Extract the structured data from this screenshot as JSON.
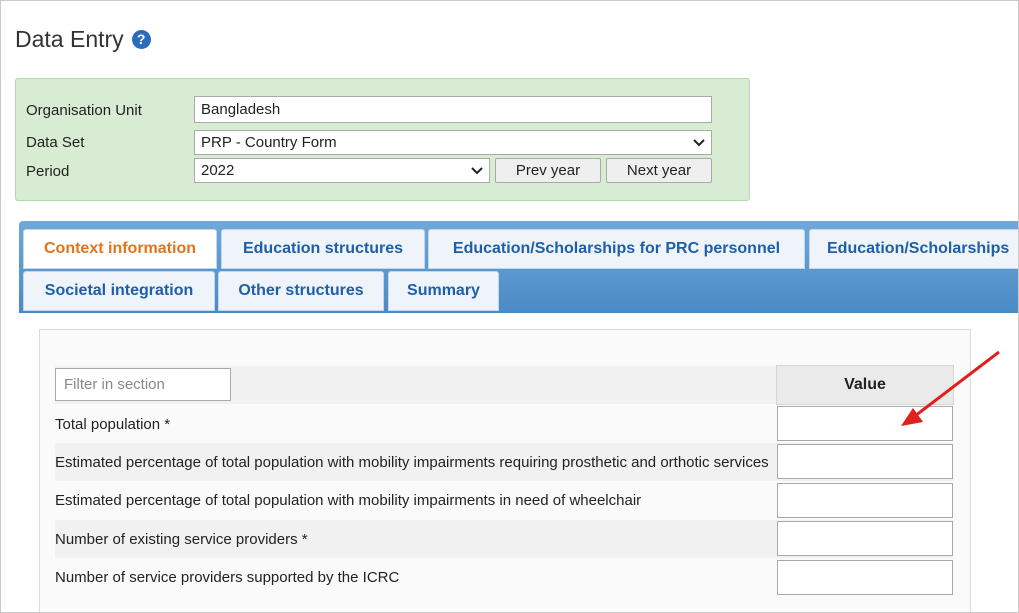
{
  "page": {
    "title": "Data Entry",
    "help_icon": "question-circle-icon"
  },
  "selection": {
    "org_unit_label": "Organisation Unit",
    "org_unit_value": "Bangladesh",
    "data_set_label": "Data Set",
    "data_set_value": "PRP - Country Form",
    "period_label": "Period",
    "period_value": "2022",
    "prev_year": "Prev year",
    "next_year": "Next year"
  },
  "tabs": [
    {
      "label": "Context information",
      "active": true
    },
    {
      "label": "Education structures"
    },
    {
      "label": "Education/Scholarships for PRC personnel"
    },
    {
      "label": "Education/Scholarships"
    },
    {
      "label": "Societal integration"
    },
    {
      "label": "Other structures"
    },
    {
      "label": "Summary"
    }
  ],
  "section": {
    "filter_placeholder": "Filter in section",
    "value_header": "Value",
    "rows": [
      {
        "label": "Total population *",
        "value": ""
      },
      {
        "label": "Estimated percentage of total population with mobility impairments requiring prosthetic and orthotic services",
        "value": ""
      },
      {
        "label": "Estimated percentage of total population with mobility impairments in need of wheelchair",
        "value": ""
      },
      {
        "label": "Number of existing service providers *",
        "value": ""
      },
      {
        "label": "Number of service providers supported by the ICRC",
        "value": ""
      }
    ]
  },
  "colors": {
    "accent_tab": "#e0751c",
    "tab_text": "#1f5fa8",
    "selection_bg": "#d7ecd3",
    "arrow": "#e0201c"
  }
}
